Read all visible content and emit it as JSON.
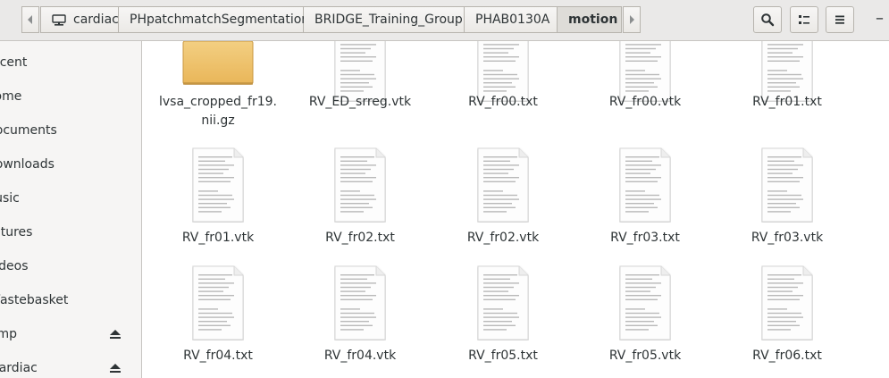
{
  "header": {
    "back_icon": "chevron-left-icon",
    "forward_icon": "chevron-right-icon",
    "breadcrumbs": [
      {
        "label": "cardiac",
        "icon": "drive-icon"
      },
      {
        "label": "PHpatchmatchSegmentation"
      },
      {
        "label": "BRIDGE_Training_Group"
      },
      {
        "label": "PHAB0130A"
      },
      {
        "label": "motion",
        "active": true
      }
    ],
    "search_icon": "search-icon",
    "view_icon": "list-view-icon",
    "menu_icon": "hamburger-menu-icon",
    "minimize_label": "–"
  },
  "sidebar": {
    "items": [
      {
        "label": "Recent"
      },
      {
        "label": "Home"
      },
      {
        "label": "Documents"
      },
      {
        "label": "Downloads"
      },
      {
        "label": "Music"
      },
      {
        "label": "Pictures"
      },
      {
        "label": "Videos"
      },
      {
        "label": "Wastebasket"
      },
      {
        "label": "tmp",
        "eject": true
      },
      {
        "label": "cardiac",
        "eject": true
      }
    ]
  },
  "files": [
    {
      "name": "lvsa_cropped_fr19.\nnii.gz",
      "type": "folder"
    },
    {
      "name": "RV_ED_srreg.vtk",
      "type": "document"
    },
    {
      "name": "RV_fr00.txt",
      "type": "document"
    },
    {
      "name": "RV_fr00.vtk",
      "type": "document"
    },
    {
      "name": "RV_fr01.txt",
      "type": "document"
    },
    {
      "name": "RV_fr01.vtk",
      "type": "document"
    },
    {
      "name": "RV_fr02.txt",
      "type": "document"
    },
    {
      "name": "RV_fr02.vtk",
      "type": "document"
    },
    {
      "name": "RV_fr03.txt",
      "type": "document"
    },
    {
      "name": "RV_fr03.vtk",
      "type": "document"
    },
    {
      "name": "RV_fr04.txt",
      "type": "document"
    },
    {
      "name": "RV_fr04.vtk",
      "type": "document"
    },
    {
      "name": "RV_fr05.txt",
      "type": "document"
    },
    {
      "name": "RV_fr05.vtk",
      "type": "document"
    },
    {
      "name": "RV_fr06.txt",
      "type": "document"
    }
  ]
}
